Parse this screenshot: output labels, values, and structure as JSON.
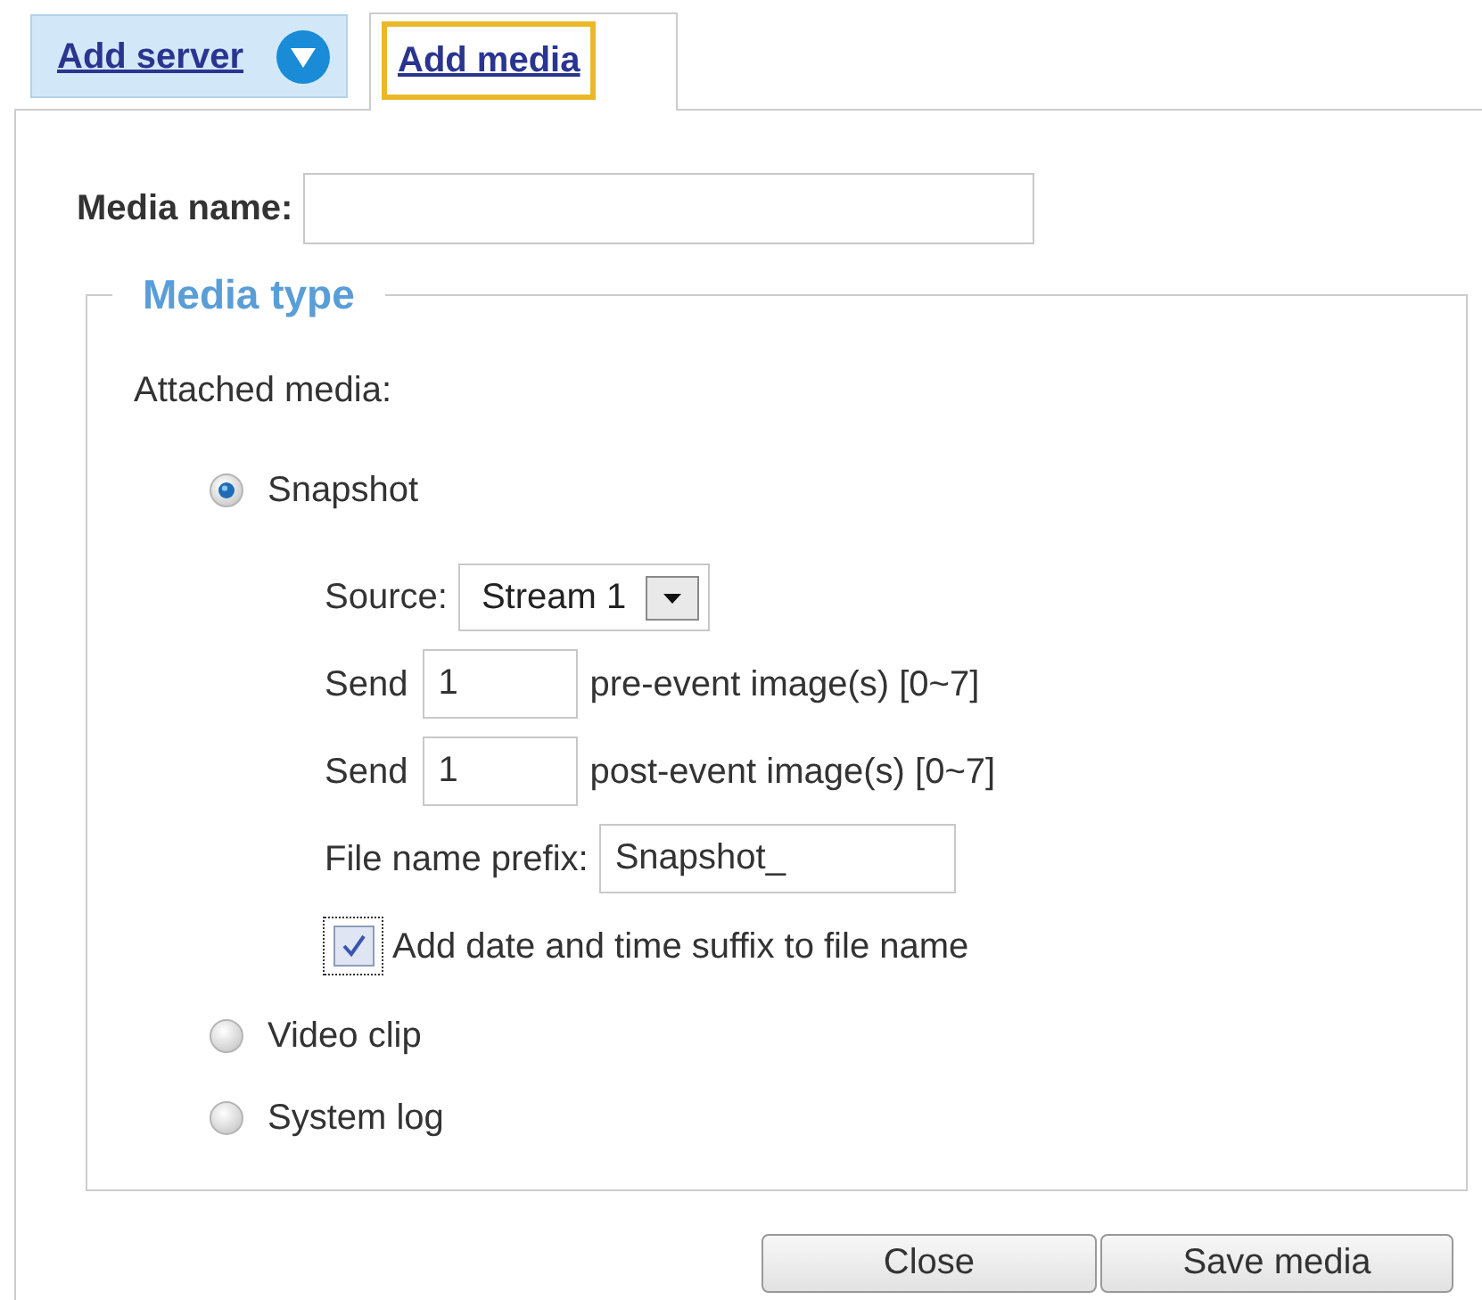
{
  "tabs": [
    {
      "label": "Add server",
      "kind": "menu",
      "selected": false,
      "focused": false
    },
    {
      "label": "Add media",
      "kind": "plain",
      "selected": true,
      "focused": true
    }
  ],
  "media_name": {
    "label": "Media name:"
  },
  "media_type": {
    "legend": "Media type",
    "label": "Attached media:",
    "options": [
      {
        "label": "Snapshot",
        "selected": true,
        "settings": {
          "source": {
            "label": "Source:",
            "value": "Stream 1"
          },
          "send": [
            {
              "label": "Send",
              "value": "1",
              "note": "pre-event image(s) [0~7]"
            },
            {
              "label": "Send",
              "value": "1",
              "note": "post-event image(s) [0~7]"
            }
          ],
          "prefix": {
            "label": "File name prefix:",
            "value": "Snapshot_"
          },
          "suffix_option": {
            "label": "Add date and time suffix to file name",
            "checked": true,
            "focused": true
          }
        }
      },
      {
        "label": "Video clip",
        "selected": false
      },
      {
        "label": "System log",
        "selected": false
      }
    ]
  },
  "buttons": [
    {
      "label": "Close"
    },
    {
      "label": "Save media"
    }
  ]
}
